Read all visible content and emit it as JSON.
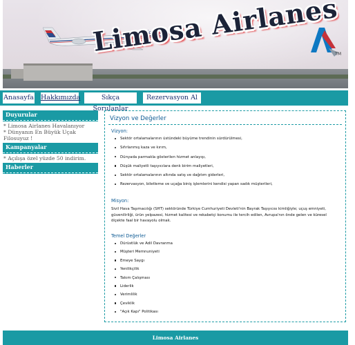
{
  "banner": {
    "site_name": "Limosa Airlanes",
    "plane_livery": "American Eagle",
    "logo_tm": "TM"
  },
  "nav": [
    {
      "label": "Anasayfa"
    },
    {
      "label": "Hakkımızda"
    },
    {
      "label": "Sıkça Sorulanlar"
    },
    {
      "label": "Rezervasyon Al"
    }
  ],
  "sidebar": {
    "duyurular_title": "Duyurular",
    "duyurular_items": [
      "* Limosa Airlanes Havalanıyor",
      "* Dünyanın En Büyük Uçak Filosuyuz !"
    ],
    "kampanyalar_title": "Kampanyalar",
    "kampanyalar_items": [
      "* Açılışa özel yüzde 50 indirim."
    ],
    "haberler_title": "Haberler"
  },
  "content": {
    "title": "Vizyon ve Değerler",
    "vizyon_label": "Vizyon:",
    "vizyon_items": [
      "Sektör ortalamalarının üstündeki büyüme trendinin sürdürülmesi,",
      "Sıfırlanmış kaza ve kırım,",
      "Dünyada parmakla gösterilen hizmet anlayışı,",
      "Düşük maliyetli taşıyıcılara denk birim maliyetleri,",
      "Sektör ortalamalarının altında satış ve dağıtım giderleri,",
      "Rezervasyon, biletleme ve uçağa biniş işlemlerini kendisi yapan sadık müşterileri,"
    ],
    "misyon_label": "Misyon:",
    "misyon_text": "Sivil Hava Taşımacılığı (SHT) sektöründe Türkiye Cumhuriyeti Devleti'nin Bayrak Taşıyıcısı kimliğiyle; uçuş emniyeti, güvenilirliği, ürün yelpazesi, hizmet kalitesi ve rekabetçi konumu ile tercih edilen, Avrupa'nın önde gelen ve küresel ölçekte faal bir havayolu olmak.",
    "temel_label": "Temel Değerler",
    "temel_items": [
      "Dürüstlük ve Adil Davranma",
      "Müşteri Memnuniyeti",
      "Emeye Saygı",
      "Yenilikçilik",
      "Takım Çalışması",
      "Liderlik",
      "Verimlilik",
      "Çeviklik",
      "\"Açık Kapı\" Politikası"
    ]
  },
  "footer": {
    "text": "Limosa Airlanes"
  },
  "colors": {
    "accent": "#1a9aa4",
    "heading": "#0d5a93",
    "nav_text": "#1a2e6e"
  }
}
